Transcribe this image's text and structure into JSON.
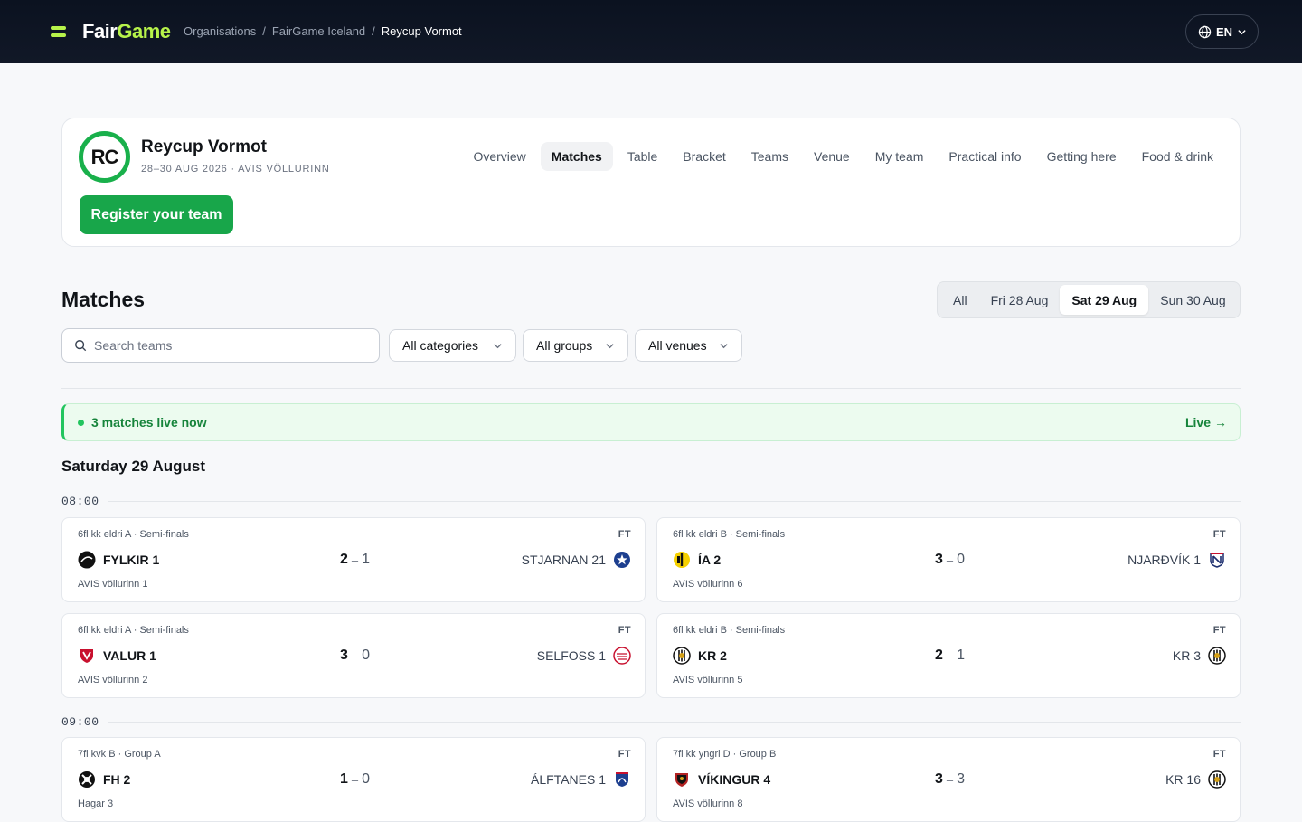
{
  "app": {
    "brand_part1": "Fair",
    "brand_part2": "Game",
    "breadcrumb": [
      "Organisations",
      "FairGame Iceland",
      "Reycup Vormot"
    ],
    "breadcrumb_sep": "/",
    "language": "EN",
    "colors": {
      "accent": "#b7f34a",
      "primary_green": "#18a64a",
      "header_bg": "#0b1220"
    }
  },
  "event": {
    "badge": "RC",
    "name": "Reycup Vormot",
    "meta": "28–30 AUG 2026 · AVIS VÖLLURINN",
    "register_label": "Register your team",
    "tabs": [
      {
        "label": "Overview",
        "active": false
      },
      {
        "label": "Matches",
        "active": true
      },
      {
        "label": "Table",
        "active": false
      },
      {
        "label": "Bracket",
        "active": false
      },
      {
        "label": "Teams",
        "active": false
      },
      {
        "label": "Venue",
        "active": false
      },
      {
        "label": "My team",
        "active": false
      },
      {
        "label": "Practical info",
        "active": false
      },
      {
        "label": "Getting here",
        "active": false
      },
      {
        "label": "Food & drink",
        "active": false
      }
    ]
  },
  "matches_page": {
    "title": "Matches",
    "day_filter": [
      {
        "label": "All",
        "active": false
      },
      {
        "label": "Fri 28 Aug",
        "active": false
      },
      {
        "label": "Sat 29 Aug",
        "active": true
      },
      {
        "label": "Sun 30 Aug",
        "active": false
      }
    ],
    "search_placeholder": "Search teams",
    "filters": {
      "categories": "All categories",
      "groups": "All groups",
      "venues": "All venues"
    },
    "live_banner": {
      "text": "3 matches live now",
      "link": "Live",
      "arrow": "→"
    },
    "date_heading": "Saturday 29 August",
    "slots": [
      {
        "time": "08:00",
        "matches": [
          {
            "category": "6fl kk eldri A · Semi-finals",
            "status": "FT",
            "home": "FYLKIR 1",
            "home_icon": "fylkir-crest-icon",
            "home_score": "2",
            "away_score": "1",
            "away": "STJARNAN 21",
            "away_icon": "stjarnan-crest-icon",
            "venue": "AVIS völlurinn 1"
          },
          {
            "category": "6fl kk eldri B · Semi-finals",
            "status": "FT",
            "home": "ÍA 2",
            "home_icon": "ia-crest-icon",
            "home_score": "3",
            "away_score": "0",
            "away": "NJARÐVÍK 1",
            "away_icon": "njardvik-crest-icon",
            "venue": "AVIS völlurinn 6"
          },
          {
            "category": "6fl kk eldri A · Semi-finals",
            "status": "FT",
            "home": "VALUR 1",
            "home_icon": "valur-crest-icon",
            "home_score": "3",
            "away_score": "0",
            "away": "SELFOSS 1",
            "away_icon": "selfoss-crest-icon",
            "venue": "AVIS völlurinn 2"
          },
          {
            "category": "6fl kk eldri B · Semi-finals",
            "status": "FT",
            "home": "KR 2",
            "home_icon": "kr-crest-icon",
            "home_score": "2",
            "away_score": "1",
            "away": "KR 3",
            "away_icon": "kr-crest-icon",
            "venue": "AVIS völlurinn 5"
          }
        ]
      },
      {
        "time": "09:00",
        "matches": [
          {
            "category": "7fl kvk B · Group A",
            "status": "FT",
            "home": "FH 2",
            "home_icon": "fh-crest-icon",
            "home_score": "1",
            "away_score": "0",
            "away": "ÁLFTANES 1",
            "away_icon": "alftanes-crest-icon",
            "venue": "Hagar 3"
          },
          {
            "category": "7fl kk yngri D · Group B",
            "status": "FT",
            "home": "VÍKINGUR 4",
            "home_icon": "vikingur-crest-icon",
            "home_score": "3",
            "away_score": "3",
            "away": "KR 16",
            "away_icon": "kr-crest-icon",
            "venue": "AVIS völlurinn 8"
          }
        ]
      }
    ]
  }
}
